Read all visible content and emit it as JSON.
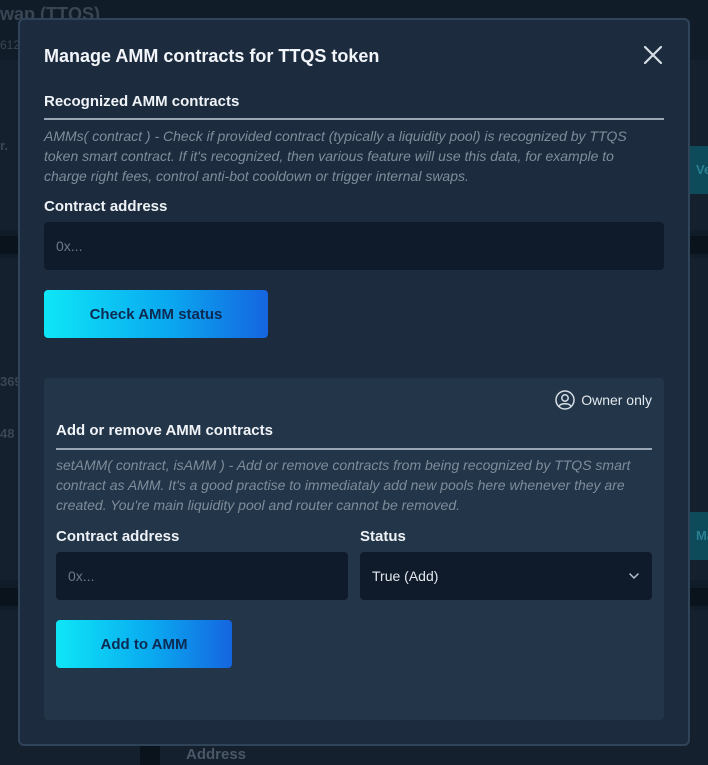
{
  "background": {
    "title": "wap (TTQS)",
    "subtitle": "612",
    "label_r": "r.",
    "num_1": "369",
    "num_2": "48",
    "cyan_1": "Ve",
    "cyan_2": "Ma",
    "bottom_label": "Address"
  },
  "modal": {
    "title": "Manage AMM contracts for TTQS token",
    "recognized": {
      "heading": "Recognized AMM contracts",
      "description": "AMMs( contract ) - Check if provided contract (typically a liquidity pool) is recognized by TTQS token smart contract. If it's recognized, then various feature will use this data, for example to charge right fees, control anti-bot cooldown or trigger internal swaps.",
      "address_label": "Contract address",
      "address_placeholder": "0x...",
      "check_button": "Check AMM status"
    },
    "add_remove": {
      "owner_only": "Owner only",
      "heading": "Add or remove AMM contracts",
      "description": "setAMM( contract, isAMM ) - Add or remove contracts from being recognized by TTQS smart contract as AMM. It's a good practise to immediataly add new pools here whenever they are created. You're main liquidity pool and router cannot be removed.",
      "address_label": "Contract address",
      "address_placeholder": "0x...",
      "status_label": "Status",
      "status_value": "True (Add)",
      "add_button": "Add to AMM"
    }
  }
}
